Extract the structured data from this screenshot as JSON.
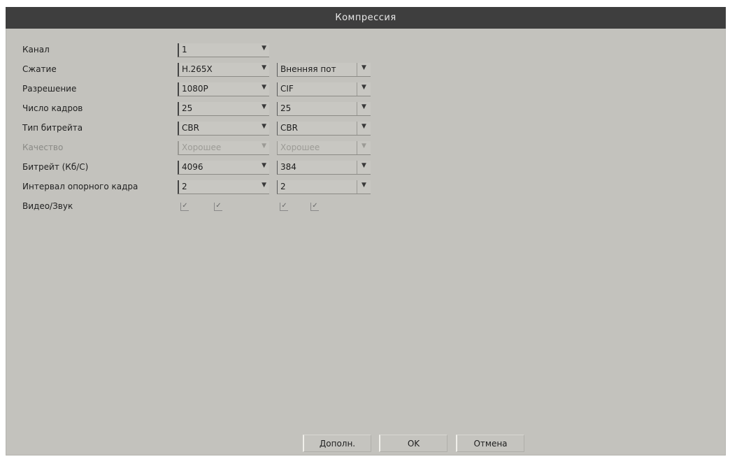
{
  "window": {
    "title": "Компрессия"
  },
  "rows": [
    {
      "label": "Канал",
      "main": "1"
    },
    {
      "label": "Сжатие",
      "main": "H.265X",
      "sub": "Вненняя пот"
    },
    {
      "label": "Разрешение",
      "main": "1080P",
      "sub": "CIF"
    },
    {
      "label": "Число кадров",
      "main": "25",
      "sub": "25"
    },
    {
      "label": "Тип битрейта",
      "main": "CBR",
      "sub": "CBR"
    },
    {
      "label": "Качество",
      "main": "Хорошее",
      "sub": "Хорошее",
      "disabled": true
    },
    {
      "label": "Битрейт (Кб/С)",
      "main": "4096",
      "sub": "384"
    },
    {
      "label": "Интервал опорного кадра",
      "main": "2",
      "sub": "2"
    },
    {
      "label": "Видео/Звук"
    }
  ],
  "buttons": {
    "advanced": "Дополн.",
    "ok": "OK",
    "cancel": "Отмена"
  },
  "icons": {
    "dropdown": "▼",
    "check": "✓"
  }
}
